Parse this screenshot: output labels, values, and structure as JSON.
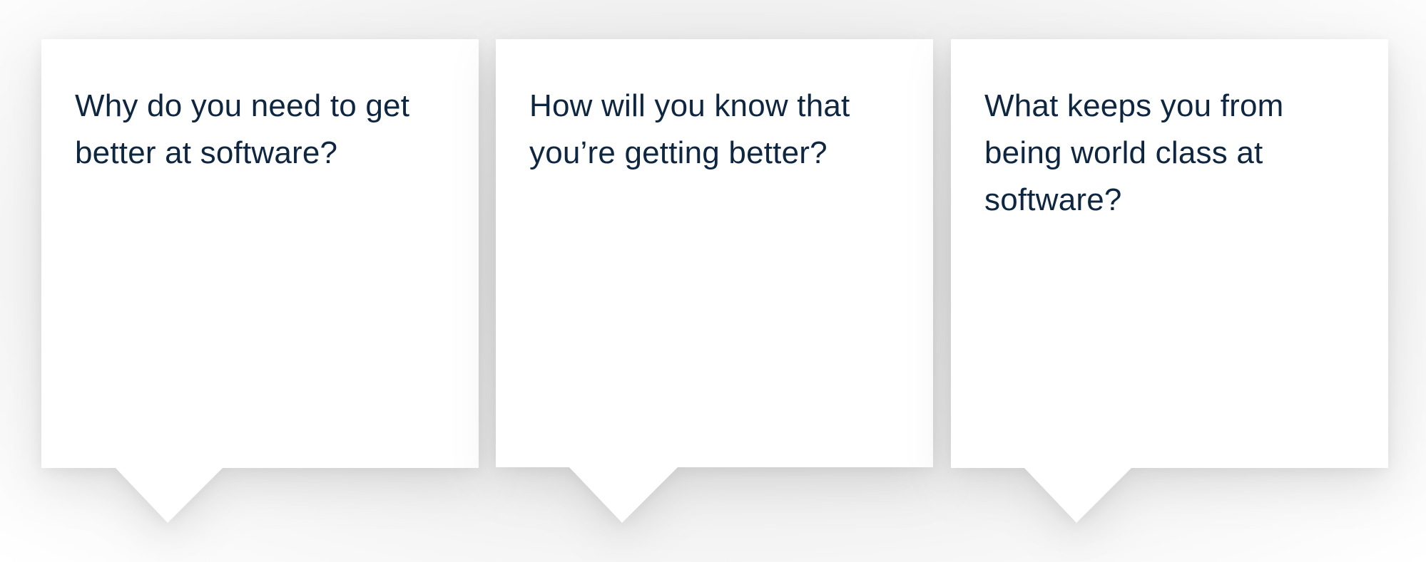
{
  "colors": {
    "card_background": "#ffffff",
    "question_text": "#0f2640"
  },
  "cards": [
    {
      "question": "Why do you need to get better at software?"
    },
    {
      "question": "How will you know that you’re getting better?"
    },
    {
      "question": "What keeps you from being world class at software?"
    }
  ]
}
